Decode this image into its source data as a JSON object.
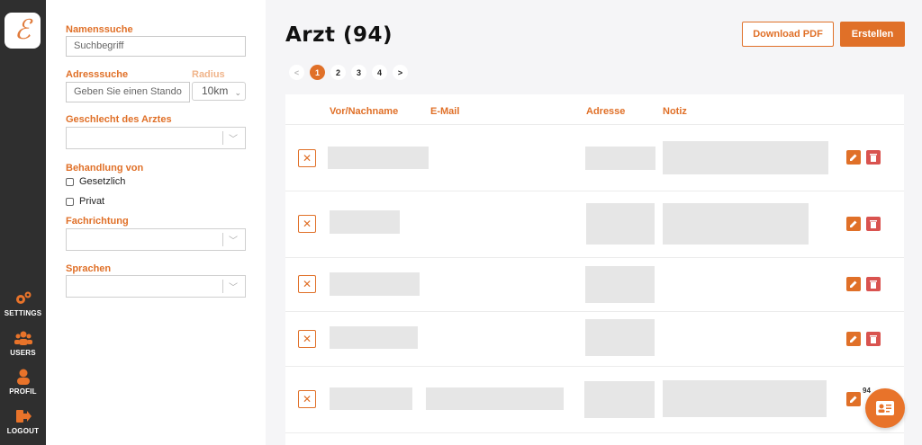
{
  "app": {
    "logo_glyph": "ℰ"
  },
  "rail": {
    "items": [
      {
        "label": "SETTINGS",
        "icon": "gears-icon"
      },
      {
        "label": "USERS",
        "icon": "users-icon"
      },
      {
        "label": "PROFIL",
        "icon": "user-icon"
      },
      {
        "label": "LOGOUT",
        "icon": "logout-icon"
      }
    ]
  },
  "filters": {
    "name_search_label": "Namenssuche",
    "name_search_placeholder": "Suchbegriff",
    "address_search_label": "Adresssuche",
    "radius_label": "Radius",
    "address_placeholder": "Geben Sie einen Stando",
    "radius_value": "10km",
    "gender_label": "Geschlecht des Arztes",
    "treatment_label": "Behandlung von",
    "treatment_options": [
      "Gesetzlich",
      "Privat"
    ],
    "specialty_label": "Fachrichtung",
    "languages_label": "Sprachen"
  },
  "main": {
    "title": "Arzt (94)",
    "download_label": "Download PDF",
    "create_label": "Erstellen",
    "pagination": {
      "prev": "<",
      "pages": [
        "1",
        "2",
        "3",
        "4"
      ],
      "current": "1",
      "next": ">"
    },
    "columns": [
      "Vor/Nachname",
      "E-Mail",
      "Adresse",
      "Notiz"
    ]
  },
  "fab": {
    "badge": "94"
  },
  "colors": {
    "accent": "#e07028",
    "danger": "#d9534f",
    "rail": "#2f2f2f"
  }
}
